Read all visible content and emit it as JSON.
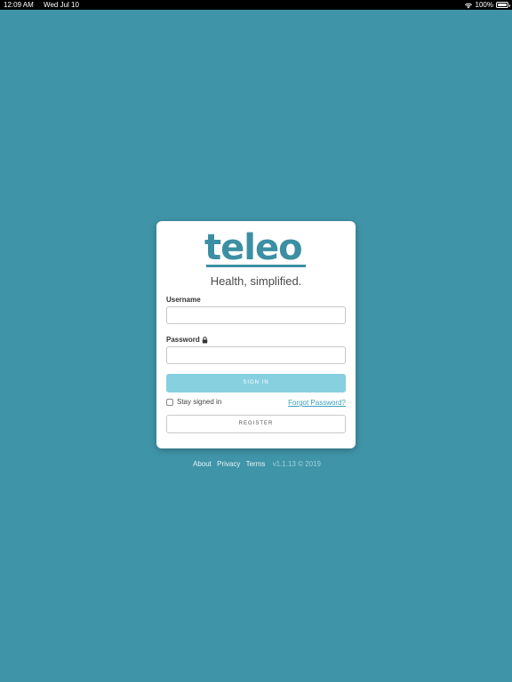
{
  "status_bar": {
    "time": "12:09 AM",
    "date": "Wed Jul 10",
    "battery": "100%"
  },
  "logo": {
    "text": "teleo"
  },
  "tagline": "Health, simplified.",
  "form": {
    "username_label": "Username",
    "username_value": "",
    "password_label": "Password",
    "password_value": "",
    "signin_label": "SIGN IN",
    "stay_signed_in_label": "Stay signed in",
    "forgot_label": "Forgot Password?",
    "register_label": "REGISTER"
  },
  "footer": {
    "about": "About",
    "privacy": "Privacy",
    "terms": "Terms",
    "version": "v1.1.13 © 2019"
  },
  "colors": {
    "background": "#4094a8",
    "brand": "#3c8fa3",
    "signin_button": "#86d0e0",
    "link": "#3a9fc0"
  }
}
